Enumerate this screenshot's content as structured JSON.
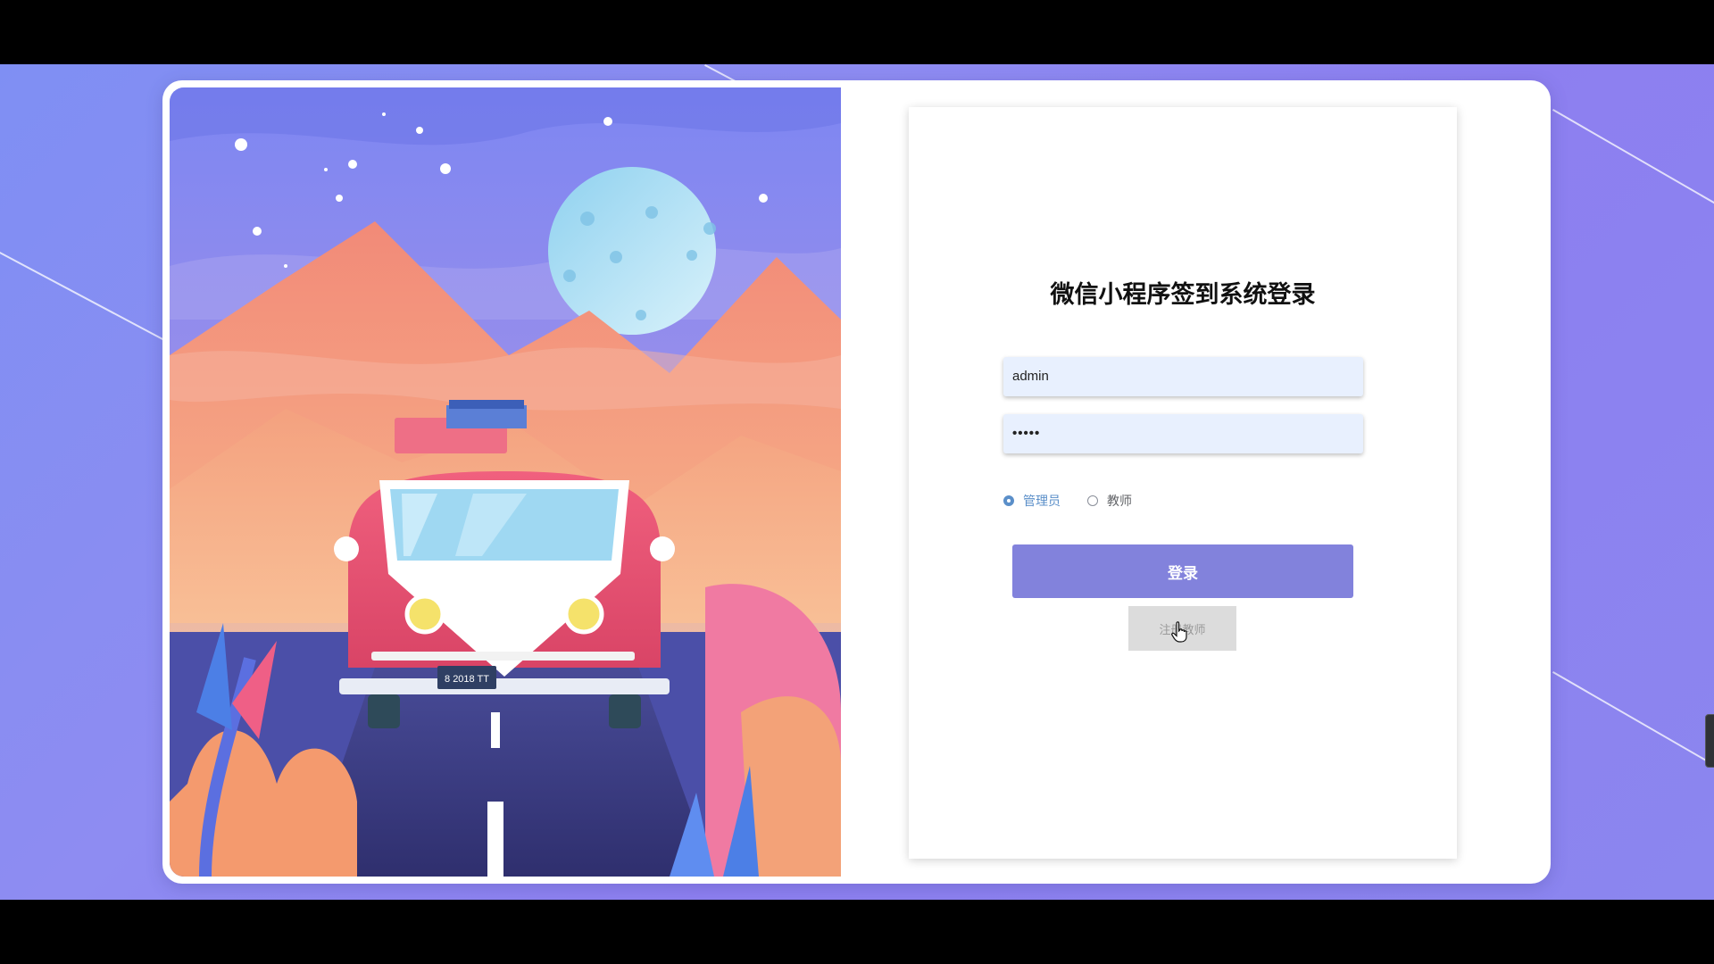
{
  "login": {
    "title": "微信小程序签到系统登录",
    "username_value": "admin",
    "password_value": "•••••",
    "roles": [
      {
        "label": "管理员",
        "checked": true
      },
      {
        "label": "教师",
        "checked": false
      }
    ],
    "login_button": "登录",
    "register_button": "注册教师"
  },
  "illustration": {
    "license_plate": "8 2018 TT"
  },
  "colors": {
    "background": "#8b8cf0",
    "login_button": "#8282dc",
    "register_button": "#dcdcdc",
    "input_fill": "#e8f0fe",
    "radio_accent": "#5b8fc9"
  }
}
